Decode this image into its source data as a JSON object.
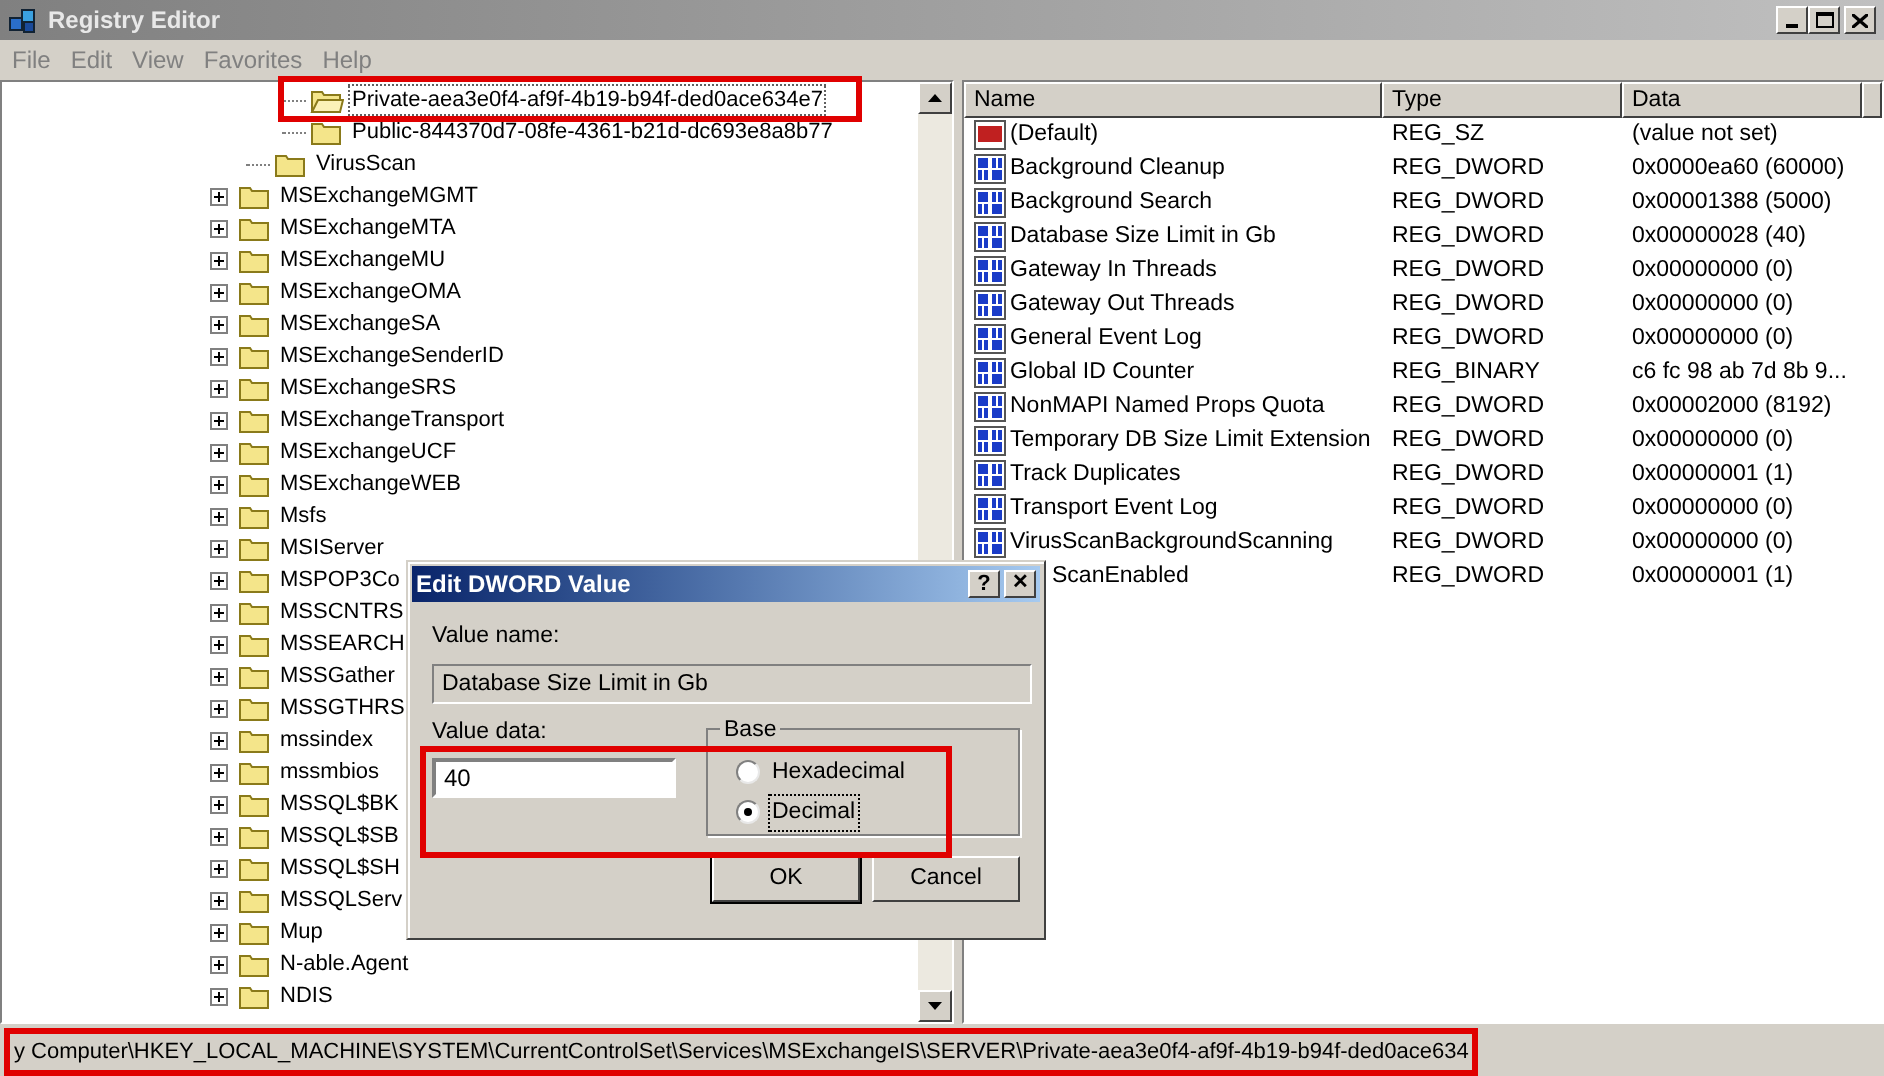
{
  "window": {
    "title": "Registry Editor"
  },
  "menu": [
    "File",
    "Edit",
    "View",
    "Favorites",
    "Help"
  ],
  "tree": {
    "items": [
      {
        "children": [
          {
            "children": [
              {
                "label": "Private-aea3e0f4-af9f-4b19-b94f-ded0ace634e7",
                "expandable": false,
                "selected": true
              },
              {
                "label": "Public-844370d7-08fe-4361-b21d-dc693e8a8b77",
                "expandable": false,
                "selected": false
              }
            ]
          },
          {
            "label": "VirusScan",
            "expandable": false,
            "selected": false
          }
        ]
      },
      {
        "label": "MSExchangeMGMT",
        "expandable": true,
        "selected": false
      },
      {
        "label": "MSExchangeMTA",
        "expandable": true,
        "selected": false
      },
      {
        "label": "MSExchangeMU",
        "expandable": true,
        "selected": false
      },
      {
        "label": "MSExchangeOMA",
        "expandable": true,
        "selected": false
      },
      {
        "label": "MSExchangeSA",
        "expandable": true,
        "selected": false
      },
      {
        "label": "MSExchangeSenderID",
        "expandable": true,
        "selected": false
      },
      {
        "label": "MSExchangeSRS",
        "expandable": true,
        "selected": false
      },
      {
        "label": "MSExchangeTransport",
        "expandable": true,
        "selected": false
      },
      {
        "label": "MSExchangeUCF",
        "expandable": true,
        "selected": false
      },
      {
        "label": "MSExchangeWEB",
        "expandable": true,
        "selected": false
      },
      {
        "label": "Msfs",
        "expandable": true,
        "selected": false
      },
      {
        "label": "MSIServer",
        "expandable": true,
        "selected": false
      },
      {
        "label": "MSPOP3Co",
        "expandable": true,
        "selected": false
      },
      {
        "label": "MSSCNTRS",
        "expandable": true,
        "selected": false
      },
      {
        "label": "MSSEARCH",
        "expandable": true,
        "selected": false
      },
      {
        "label": "MSSGather",
        "expandable": true,
        "selected": false
      },
      {
        "label": "MSSGTHRS",
        "expandable": true,
        "selected": false
      },
      {
        "label": "mssindex",
        "expandable": true,
        "selected": false
      },
      {
        "label": "mssmbios",
        "expandable": true,
        "selected": false
      },
      {
        "label": "MSSQL$BK",
        "expandable": true,
        "selected": false
      },
      {
        "label": "MSSQL$SB",
        "expandable": true,
        "selected": false
      },
      {
        "label": "MSSQL$SH",
        "expandable": true,
        "selected": false
      },
      {
        "label": "MSSQLServ",
        "expandable": true,
        "selected": false
      },
      {
        "label": "Mup",
        "expandable": true,
        "selected": false
      },
      {
        "label": "N-able.Agent",
        "expandable": true,
        "selected": false
      },
      {
        "label": "NDIS",
        "expandable": true,
        "selected": false
      }
    ]
  },
  "values": {
    "columns": [
      "Name",
      "Type",
      "Data"
    ],
    "rows": [
      {
        "kind": "string",
        "name": "(Default)",
        "type": "REG_SZ",
        "data": "(value not set)"
      },
      {
        "kind": "number",
        "name": "Background Cleanup",
        "type": "REG_DWORD",
        "data": "0x0000ea60 (60000)"
      },
      {
        "kind": "number",
        "name": "Background Search",
        "type": "REG_DWORD",
        "data": "0x00001388 (5000)"
      },
      {
        "kind": "number",
        "name": "Database Size Limit in Gb",
        "type": "REG_DWORD",
        "data": "0x00000028 (40)"
      },
      {
        "kind": "number",
        "name": "Gateway In Threads",
        "type": "REG_DWORD",
        "data": "0x00000000 (0)"
      },
      {
        "kind": "number",
        "name": "Gateway Out Threads",
        "type": "REG_DWORD",
        "data": "0x00000000 (0)"
      },
      {
        "kind": "number",
        "name": "General Event Log",
        "type": "REG_DWORD",
        "data": "0x00000000 (0)"
      },
      {
        "kind": "number",
        "name": "Global ID Counter",
        "type": "REG_BINARY",
        "data": "c6 fc 98 ab 7d 8b 9..."
      },
      {
        "kind": "number",
        "name": "NonMAPI Named Props Quota",
        "type": "REG_DWORD",
        "data": "0x00002000 (8192)"
      },
      {
        "kind": "number",
        "name": "Temporary DB Size Limit Extension",
        "type": "REG_DWORD",
        "data": "0x00000000 (0)"
      },
      {
        "kind": "number",
        "name": "Track Duplicates",
        "type": "REG_DWORD",
        "data": "0x00000001 (1)"
      },
      {
        "kind": "number",
        "name": "Transport Event Log",
        "type": "REG_DWORD",
        "data": "0x00000000 (0)"
      },
      {
        "kind": "number",
        "name": "VirusScanBackgroundScanning",
        "type": "REG_DWORD",
        "data": "0x00000000 (0)"
      },
      {
        "kind": "covered",
        "name": "ScanEnabled",
        "type": "REG_DWORD",
        "data": "0x00000001 (1)"
      }
    ]
  },
  "dialog": {
    "title": "Edit DWORD Value",
    "help_button": "?",
    "close_button": "✕",
    "name_label": "Value name:",
    "name_value": "Database Size Limit in Gb",
    "data_label": "Value data:",
    "data_value": "40",
    "base_label": "Base",
    "bases": [
      {
        "label": "Hexadecimal",
        "selected": false
      },
      {
        "label": "Decimal",
        "selected": true
      }
    ],
    "buttons": [
      "OK",
      "Cancel"
    ]
  },
  "status_bar": "y Computer\\HKEY_LOCAL_MACHINE\\SYSTEM\\CurrentControlSet\\Services\\MSExchangeIS\\SERVER\\Private-aea3e0f4-af9f-4b19-b94f-ded0ace634"
}
